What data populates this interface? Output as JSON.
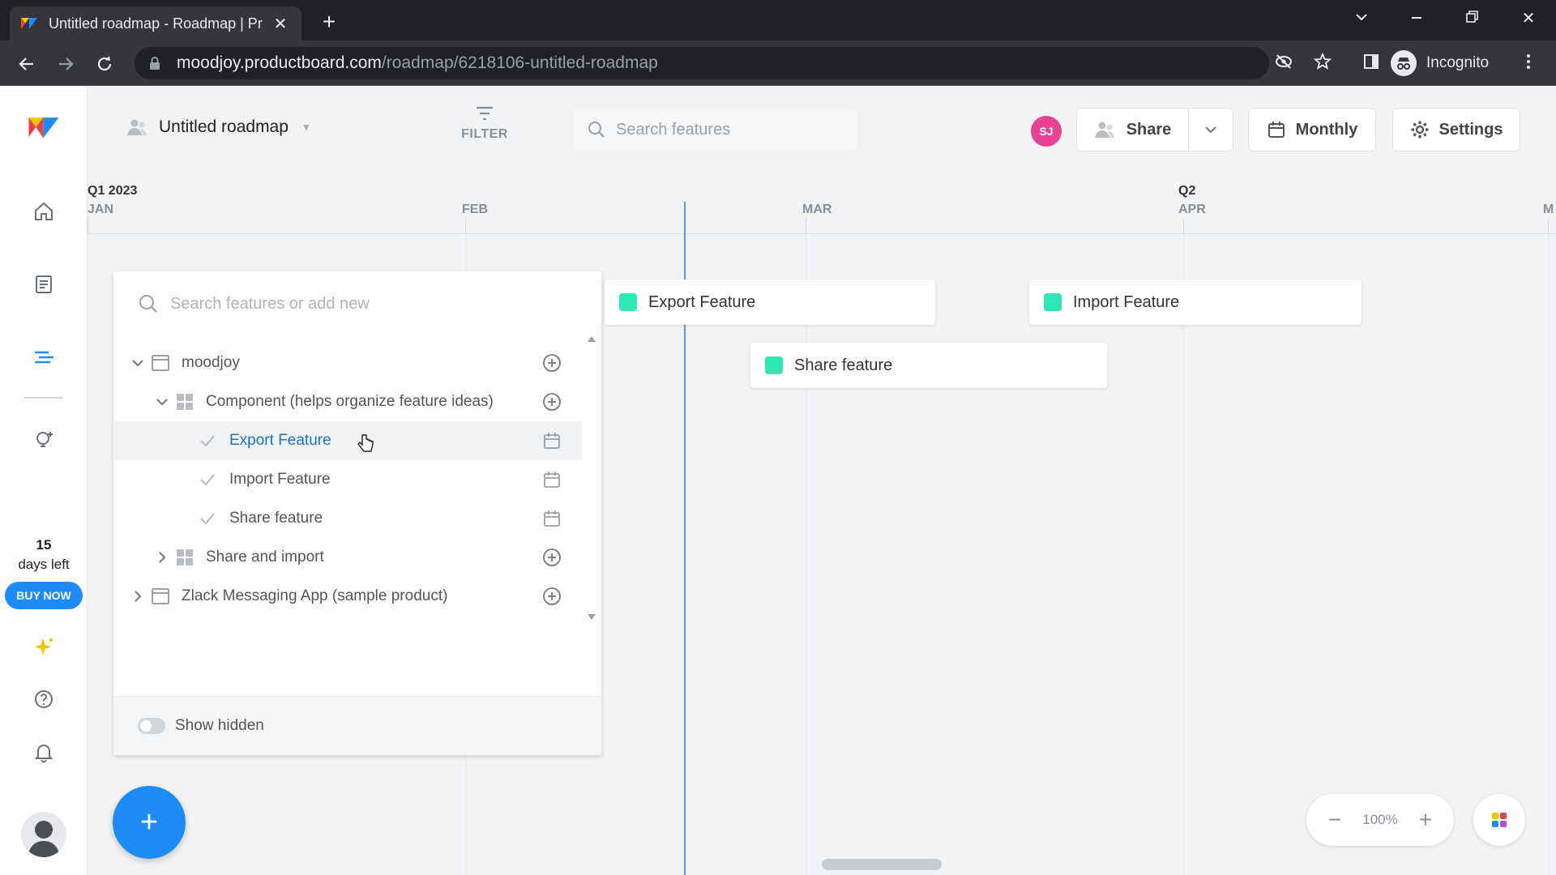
{
  "browser": {
    "tab_title": "Untitled roadmap - Roadmap | Pr",
    "url_host": "moodjoy.productboard.com",
    "url_path": "/roadmap/6218106-untitled-roadmap",
    "profile_label": "Incognito"
  },
  "sidebar": {
    "trial_days": "15",
    "trial_text": "days left",
    "buy_now": "BUY NOW"
  },
  "header": {
    "roadmap_title": "Untitled roadmap",
    "filter_label": "FILTER",
    "search_placeholder": "Search features",
    "user_initials": "SJ",
    "share_label": "Share",
    "monthly_label": "Monthly",
    "settings_label": "Settings"
  },
  "timeline": {
    "quarters": [
      "Q1 2023",
      "Q2"
    ],
    "months": [
      "JAN",
      "FEB",
      "MAR",
      "APR",
      "M"
    ],
    "bars": [
      {
        "label": "Export Feature",
        "color": "#2ee6b6"
      },
      {
        "label": "Import Feature",
        "color": "#2ee6b6"
      },
      {
        "label": "Share feature",
        "color": "#2ee6b6"
      }
    ]
  },
  "panel": {
    "search_placeholder": "Search features or add new",
    "tree": [
      {
        "label": "moodjoy"
      },
      {
        "label": "Component (helps organize feature ideas)"
      },
      {
        "label": "Export Feature"
      },
      {
        "label": "Import Feature"
      },
      {
        "label": "Share feature"
      },
      {
        "label": "Share and import"
      },
      {
        "label": "Zlack Messaging App (sample product)"
      }
    ],
    "show_hidden_label": "Show hidden"
  },
  "zoom": {
    "value": "100%",
    "minus": "−",
    "plus": "+"
  },
  "fab_label": "+"
}
